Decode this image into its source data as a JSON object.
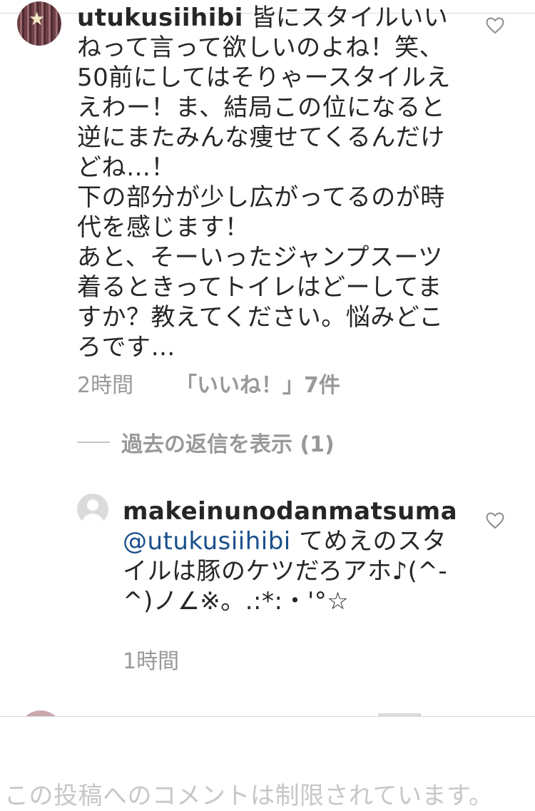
{
  "comment": {
    "username": "utukusiihibi",
    "text": " 皆にスタイルいいねって言って欲しいのよね！笑、50前にしてはそりゃースタイルええわー！ま、結局この位になると逆にまたみんな痩せてくるんだけどね…！\n下の部分が少し広がってるのが時代を感じます！\nあと、そーいったジャンプスーツ着るときってトイレはどーしてますか？教えてください。悩みどころです…",
    "time": "2時間",
    "likes": "「いいね！」7件",
    "view_replies": "過去の返信を表示 (1)"
  },
  "reply": {
    "username": "makeinunodanmatsuma",
    "mention": "@utukusiihibi",
    "text": " てめえのスタイルは豚のケツだろアホ♪(^-^)ノ∠※。.:*:・'°☆",
    "time": "1時間"
  },
  "footer": {
    "restricted_notice": "この投稿へのコメントは制限されています。"
  },
  "icons": {
    "like": "heart-outline-icon",
    "default_avatar": "person-silhouette-icon"
  },
  "colors": {
    "text": "#262626",
    "meta": "#999999",
    "mention": "#1a4f8b",
    "divider": "#dbdbdb"
  }
}
